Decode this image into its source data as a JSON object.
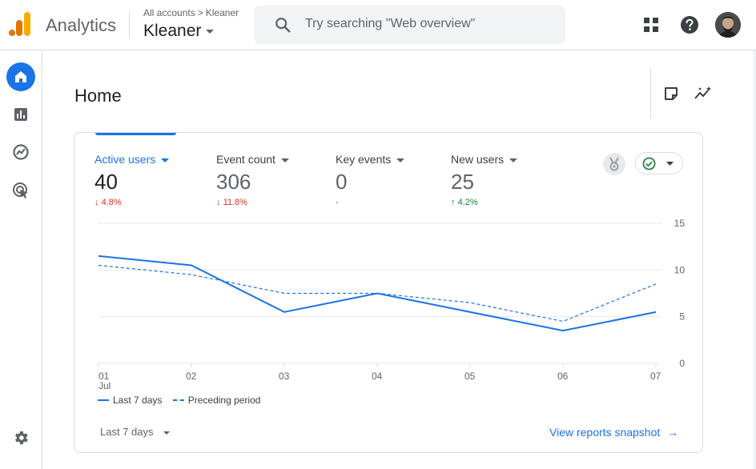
{
  "header": {
    "app_title": "Analytics",
    "breadcrumb_root": "All accounts",
    "breadcrumb_sep": ">",
    "breadcrumb_account": "Kleaner",
    "account_name": "Kleaner",
    "search_placeholder": "Try searching \"Web overview\""
  },
  "icons": {
    "apps": "apps-grid-icon",
    "help": "help-icon",
    "search": "search-icon"
  },
  "nav": {
    "items": [
      "home-icon",
      "reports-icon",
      "explore-icon",
      "advertising-icon"
    ],
    "settings": "settings-icon"
  },
  "page": {
    "title": "Home"
  },
  "metrics": [
    {
      "label": "Active users",
      "value": "40",
      "change": "4.8%",
      "direction": "down",
      "arrow": "↓"
    },
    {
      "label": "Event count",
      "value": "306",
      "change": "11.8%",
      "direction": "down",
      "arrow": "↓"
    },
    {
      "label": "Key events",
      "value": "0",
      "change": "-",
      "direction": "flat",
      "arrow": ""
    },
    {
      "label": "New users",
      "value": "25",
      "change": "4.2%",
      "direction": "up",
      "arrow": "↑"
    }
  ],
  "chart_data": {
    "type": "line",
    "categories": [
      "01",
      "02",
      "03",
      "04",
      "05",
      "06",
      "07"
    ],
    "x_sublabel_first": "Jul",
    "series": [
      {
        "name": "Last 7 days",
        "values": [
          11.5,
          10.5,
          5.5,
          7.5,
          5.5,
          3.5,
          5.5
        ],
        "style": "solid"
      },
      {
        "name": "Preceding period",
        "values": [
          10.5,
          9.5,
          7.5,
          7.5,
          6.5,
          4.5,
          8.5
        ],
        "style": "dashed"
      }
    ],
    "yticks": [
      0,
      5,
      10,
      15
    ],
    "ylim": [
      0,
      15
    ],
    "y_axis_side": "right",
    "grid": true,
    "legend_position": "bottom-left",
    "color": "#1a73e8"
  },
  "footer": {
    "date_range": "Last 7 days",
    "view_link": "View reports snapshot",
    "view_link_arrow": "→"
  },
  "colors": {
    "accent": "#1a73e8",
    "down": "#d93025",
    "up": "#188038"
  }
}
